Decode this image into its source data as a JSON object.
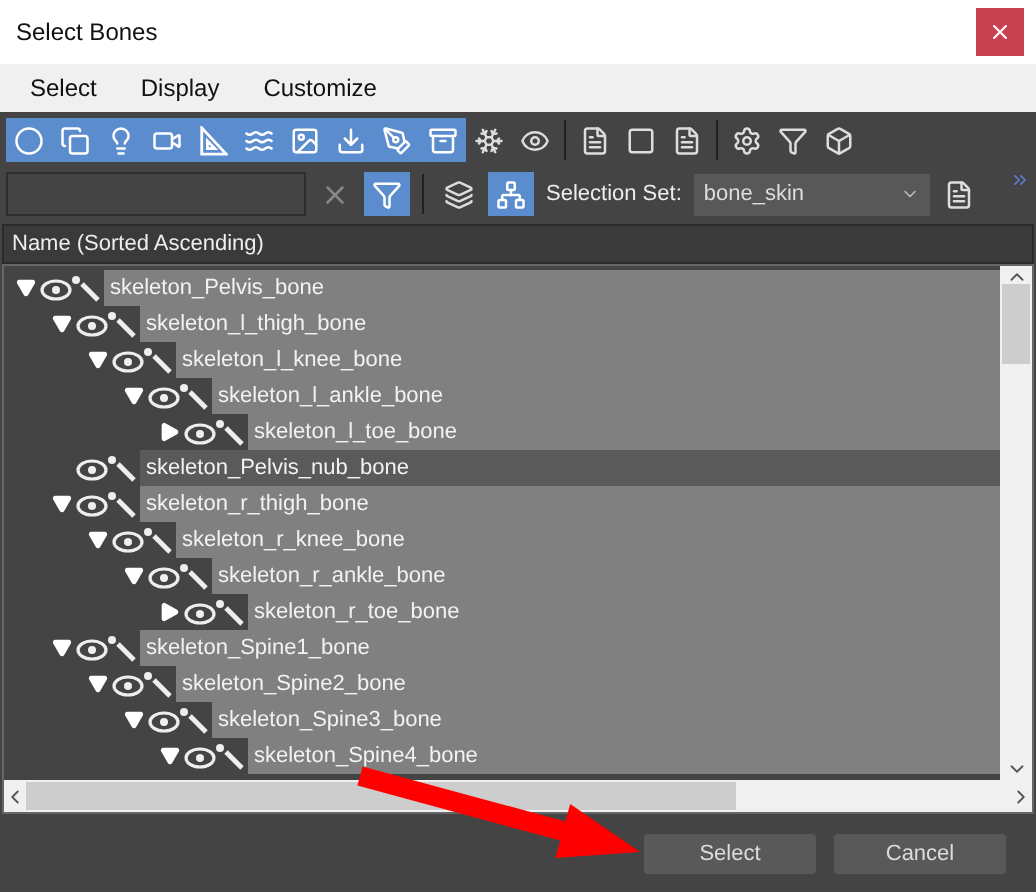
{
  "window": {
    "title": "Select Bones"
  },
  "menu": [
    "Select",
    "Display",
    "Customize"
  ],
  "toolbar": [
    {
      "kind": "geometry",
      "on": true
    },
    {
      "kind": "shapes",
      "on": true
    },
    {
      "kind": "lights",
      "on": true
    },
    {
      "kind": "cameras",
      "on": true
    },
    {
      "kind": "helpers",
      "on": true
    },
    {
      "kind": "warps",
      "on": true
    },
    {
      "kind": "groups",
      "on": true
    },
    {
      "kind": "xrefs",
      "on": true
    },
    {
      "kind": "bones",
      "on": true
    },
    {
      "kind": "containers",
      "on": true
    },
    {
      "kind": "frozen",
      "on": false
    },
    {
      "kind": "hidden",
      "on": false
    },
    {
      "kind": "divider"
    },
    {
      "kind": "select_all",
      "on": false
    },
    {
      "kind": "select_none",
      "on": false
    },
    {
      "kind": "invert",
      "on": false
    },
    {
      "kind": "divider"
    },
    {
      "kind": "filter_settings",
      "on": false
    },
    {
      "kind": "filter",
      "on": false
    },
    {
      "kind": "container_box",
      "on": false
    }
  ],
  "search_bar": {
    "filter_on": true,
    "layers_on": false,
    "hierarchy_on": true,
    "selection_set_label": "Selection Set:",
    "selection_set": "bone_skin"
  },
  "header": "Name (Sorted Ascending)",
  "tree": [
    {
      "name": "skeleton_Pelvis_bone",
      "selected": true,
      "expanded": true,
      "children": [
        {
          "name": "skeleton_l_thigh_bone",
          "selected": true,
          "expanded": true,
          "children": [
            {
              "name": "skeleton_l_knee_bone",
              "selected": true,
              "expanded": true,
              "children": [
                {
                  "name": "skeleton_l_ankle_bone",
                  "selected": true,
                  "expanded": true,
                  "children": [
                    {
                      "name": "skeleton_l_toe_bone",
                      "selected": true,
                      "expanded": false
                    }
                  ]
                }
              ]
            }
          ]
        },
        {
          "name": "skeleton_Pelvis_nub_bone",
          "selected": false
        },
        {
          "name": "skeleton_r_thigh_bone",
          "selected": true,
          "expanded": true,
          "children": [
            {
              "name": "skeleton_r_knee_bone",
              "selected": true,
              "expanded": true,
              "children": [
                {
                  "name": "skeleton_r_ankle_bone",
                  "selected": true,
                  "expanded": true,
                  "children": [
                    {
                      "name": "skeleton_r_toe_bone",
                      "selected": true,
                      "expanded": false
                    }
                  ]
                }
              ]
            }
          ]
        },
        {
          "name": "skeleton_Spine1_bone",
          "selected": true,
          "expanded": true,
          "children": [
            {
              "name": "skeleton_Spine2_bone",
              "selected": true,
              "expanded": true,
              "children": [
                {
                  "name": "skeleton_Spine3_bone",
                  "selected": true,
                  "expanded": true,
                  "children": [
                    {
                      "name": "skeleton_Spine4_bone",
                      "selected": true,
                      "expanded": true
                    }
                  ]
                }
              ]
            }
          ]
        }
      ]
    }
  ],
  "buttons": [
    "Select",
    "Cancel"
  ]
}
